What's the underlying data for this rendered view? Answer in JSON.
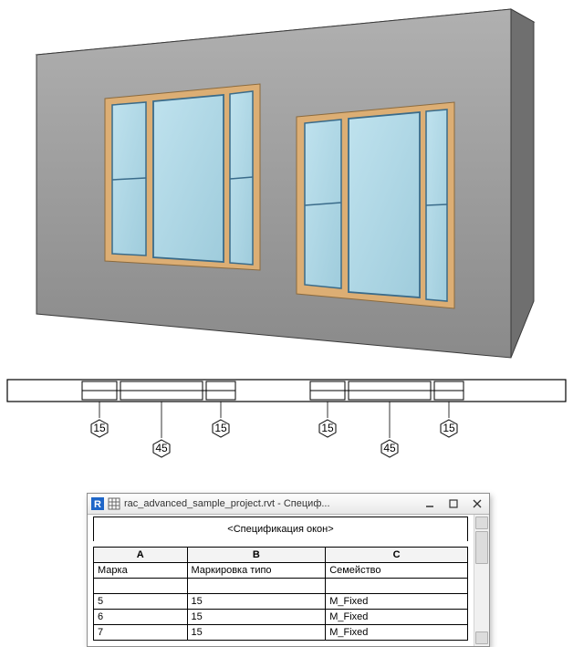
{
  "schedule": {
    "window_title": "rac_advanced_sample_project.rvt - Специф...",
    "title": "<Спецификация окон>",
    "col_letters": [
      "A",
      "B",
      "C"
    ],
    "col_headers": [
      "Марка",
      "Маркировка типо",
      "Семейство"
    ],
    "rows": [
      {
        "mark": "5",
        "type": "15",
        "family": "M_Fixed"
      },
      {
        "mark": "6",
        "type": "15",
        "family": "M_Fixed"
      },
      {
        "mark": "7",
        "type": "15",
        "family": "M_Fixed"
      }
    ]
  },
  "plan_dims": {
    "side1": "15",
    "side2": "15",
    "side3": "15",
    "side4": "15",
    "mid1": "45",
    "mid2": "45"
  }
}
